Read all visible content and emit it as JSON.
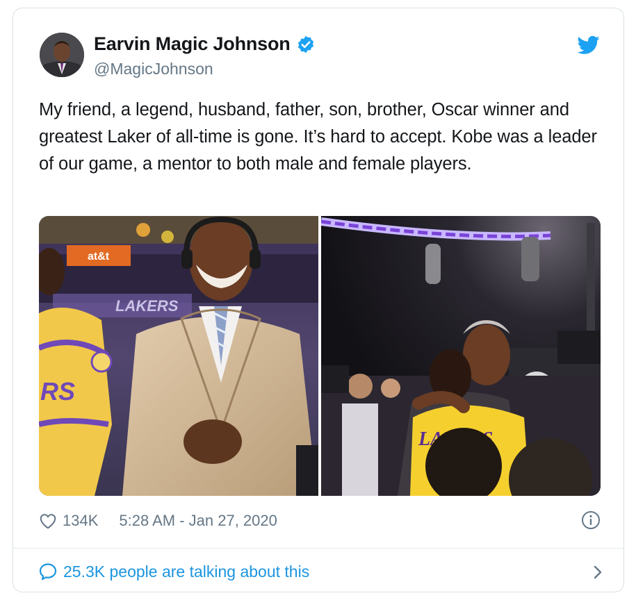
{
  "tweet": {
    "author_name": "Earvin Magic Johnson",
    "author_handle": "@MagicJohnson",
    "text": "My friend, a legend, husband, father, son, brother, Oscar winner and greatest Laker of all-time is gone. It’s hard to accept. Kobe was a leader of our game, a mentor to both male and female players.",
    "likes": "134K",
    "timestamp": "5:28 AM - Jan 27, 2020",
    "talking": "25.3K people are talking about this"
  },
  "photos": {
    "left_signage": "at&t",
    "left_banner": "LAKERS",
    "left_jersey": "RS",
    "right_jersey": "LAKERS"
  },
  "colors": {
    "link_blue": "#1b95e0",
    "verified_blue": "#1da1f2",
    "muted_gray": "#657786"
  },
  "icons": [
    "verified-badge-icon",
    "twitter-bird-icon",
    "heart-icon",
    "info-icon",
    "speech-bubble-icon",
    "chevron-right-icon"
  ]
}
